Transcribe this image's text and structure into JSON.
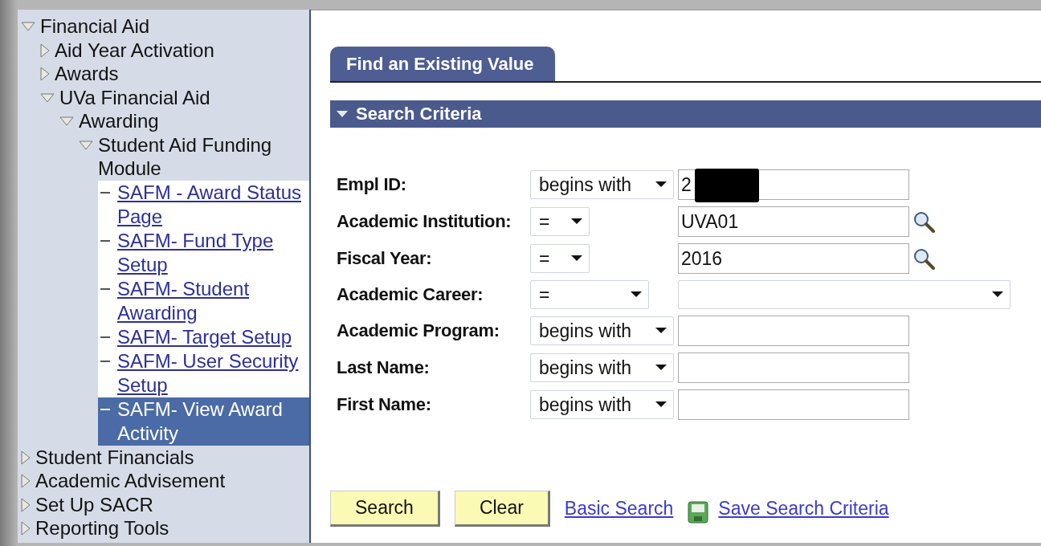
{
  "sidebar": {
    "items": [
      {
        "label": "Financial Aid",
        "kind": "folder",
        "expanded": true,
        "children": [
          {
            "label": "Aid Year Activation",
            "kind": "folder",
            "expanded": false
          },
          {
            "label": "Awards",
            "kind": "folder",
            "expanded": false
          },
          {
            "label": "UVa Financial Aid",
            "kind": "folder",
            "expanded": true,
            "children": [
              {
                "label": "Awarding",
                "kind": "folder",
                "expanded": true,
                "children": [
                  {
                    "label": "Student Aid Funding Module",
                    "kind": "folder",
                    "expanded": true,
                    "children": [
                      {
                        "label": "SAFM - Award Status Page",
                        "kind": "link",
                        "selected": false
                      },
                      {
                        "label": "SAFM- Fund Type Setup",
                        "kind": "link",
                        "selected": false
                      },
                      {
                        "label": "SAFM- Student Awarding",
                        "kind": "link",
                        "selected": false
                      },
                      {
                        "label": "SAFM- Target Setup",
                        "kind": "link",
                        "selected": false
                      },
                      {
                        "label": "SAFM- User Security Setup",
                        "kind": "link",
                        "selected": false
                      },
                      {
                        "label": "SAFM- View Award Activity",
                        "kind": "link",
                        "selected": true
                      }
                    ]
                  }
                ]
              }
            ]
          }
        ]
      },
      {
        "label": "Student Financials",
        "kind": "folder",
        "expanded": false
      },
      {
        "label": "Academic Advisement",
        "kind": "folder",
        "expanded": false
      },
      {
        "label": "Set Up SACR",
        "kind": "folder",
        "expanded": false
      },
      {
        "label": "Reporting Tools",
        "kind": "folder",
        "expanded": false
      }
    ]
  },
  "tabs": [
    {
      "label": "Find an Existing Value",
      "selected": true
    }
  ],
  "section": {
    "title": "Search Criteria",
    "expanded": true
  },
  "fields": [
    {
      "label": "Empl ID:",
      "operator": "begins with",
      "kind": "text",
      "value": "2",
      "redacted": true
    },
    {
      "label": "Academic Institution:",
      "operator": "=",
      "kind": "lookup",
      "value": "UVA01"
    },
    {
      "label": "Fiscal Year:",
      "operator": "=",
      "kind": "lookup",
      "value": "2016"
    },
    {
      "label": "Academic Career:",
      "operator": "=",
      "kind": "dropdown"
    },
    {
      "label": "Academic Program:",
      "operator": "begins with",
      "kind": "text"
    },
    {
      "label": "Last Name:",
      "operator": "begins with",
      "kind": "text"
    },
    {
      "label": "First Name:",
      "operator": "begins with",
      "kind": "text"
    }
  ],
  "buttons": [
    "Search",
    "Clear"
  ],
  "links": [
    {
      "label": "Basic Search",
      "kind": "plain"
    },
    {
      "label": "Save Search Criteria",
      "kind": "save"
    }
  ]
}
